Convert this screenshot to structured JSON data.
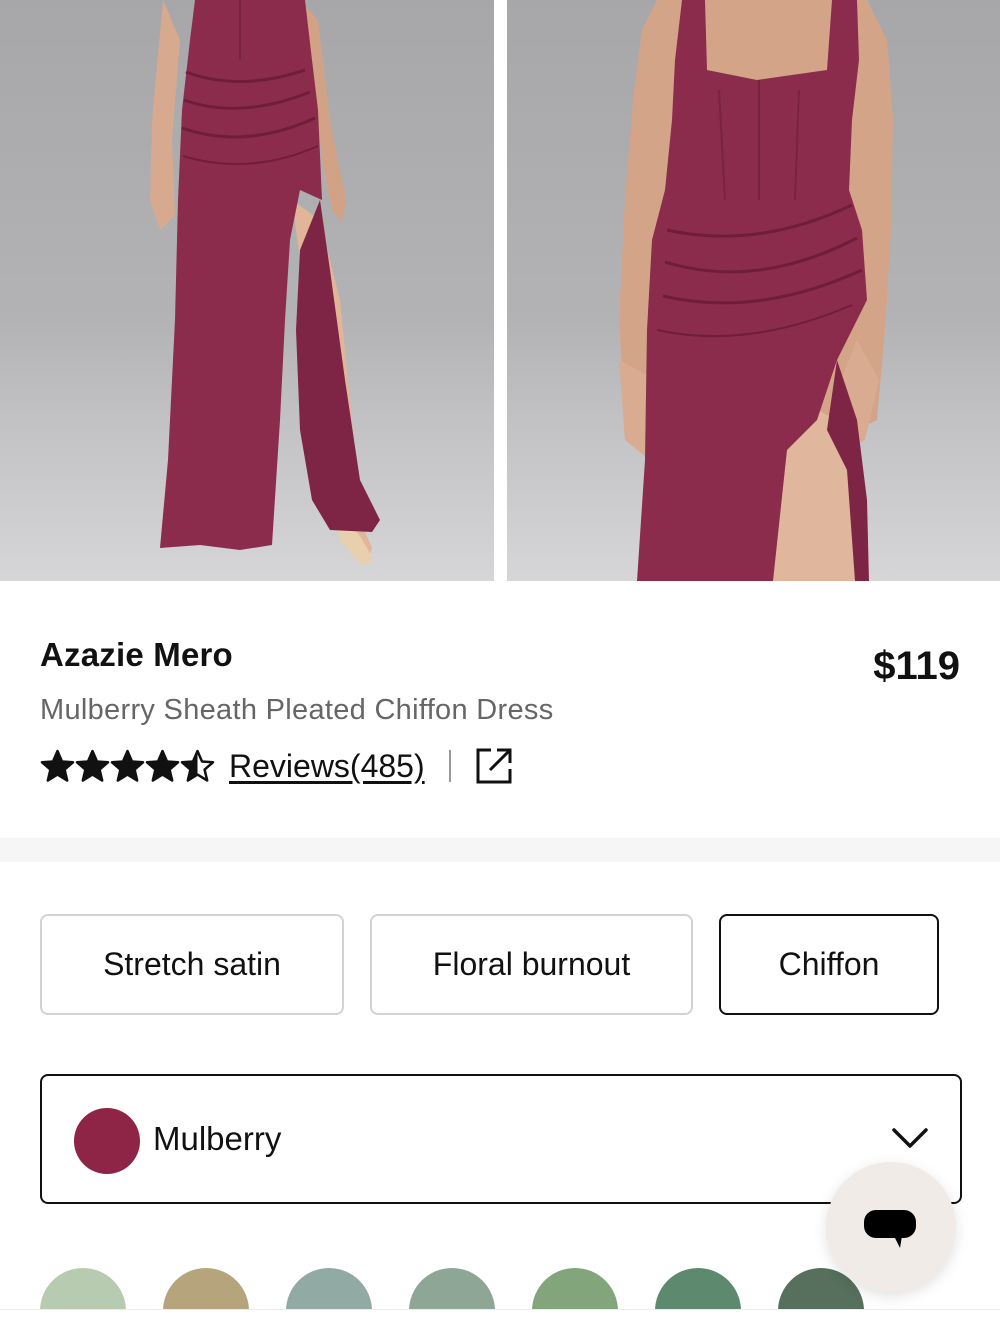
{
  "product": {
    "brand": "Azazie Mero",
    "description": "Mulberry Sheath Pleated Chiffon Dress",
    "price": "$119",
    "rating": 4.5,
    "rating_max": 5,
    "reviews_label": "Reviews(485)"
  },
  "fabrics": [
    {
      "label": "Stretch satin",
      "selected": false
    },
    {
      "label": "Floral burnout",
      "selected": false
    },
    {
      "label": "Chiffon",
      "selected": true
    }
  ],
  "color_select": {
    "label": "Mulberry",
    "swatch_color": "#8e2446"
  },
  "swatches": [
    "#b7cbb0",
    "#b6a47c",
    "#91aba4",
    "#8ea695",
    "#82a57c",
    "#5d8a6e",
    "#56705d"
  ],
  "colors": {
    "dress": "#8b2c4d",
    "chat_bg": "#f1ebe7"
  },
  "icons": {
    "share": "external-link-icon",
    "chevron": "chevron-down-icon",
    "chat": "chat-icon"
  }
}
